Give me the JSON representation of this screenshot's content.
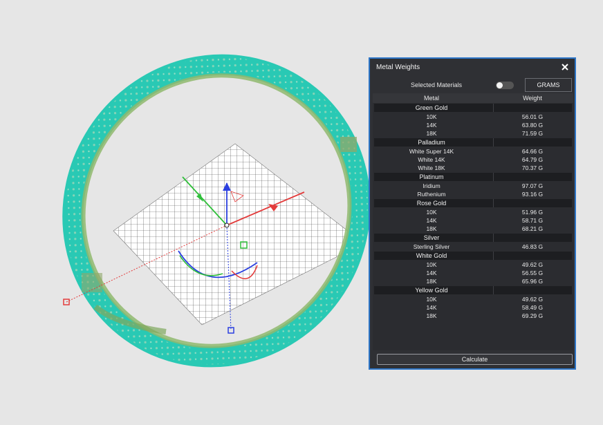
{
  "panel": {
    "title": "Metal Weights",
    "selected_label": "Selected Materials",
    "selected_toggle_on": false,
    "units_button": "GRAMS",
    "col_metal": "Metal",
    "col_weight": "Weight",
    "groups": [
      {
        "name": "Green Gold",
        "items": [
          {
            "name": "10K",
            "weight": "56.01 G"
          },
          {
            "name": "14K",
            "weight": "63.80 G"
          },
          {
            "name": "18K",
            "weight": "71.59 G"
          }
        ]
      },
      {
        "name": "Palladium",
        "items": [
          {
            "name": "White Super 14K",
            "weight": "64.66 G"
          },
          {
            "name": "White 14K",
            "weight": "64.79 G"
          },
          {
            "name": "White 18K",
            "weight": "70.37 G"
          }
        ]
      },
      {
        "name": "Platinum",
        "items": [
          {
            "name": "Iridium",
            "weight": "97.07 G"
          },
          {
            "name": "Ruthenium",
            "weight": "93.16 G"
          }
        ]
      },
      {
        "name": "Rose Gold",
        "items": [
          {
            "name": "10K",
            "weight": "51.96 G"
          },
          {
            "name": "14K",
            "weight": "58.71 G"
          },
          {
            "name": "18K",
            "weight": "68.21 G"
          }
        ]
      },
      {
        "name": "Silver",
        "items": [
          {
            "name": "Sterling Silver",
            "weight": "46.83 G"
          }
        ]
      },
      {
        "name": "White Gold",
        "items": [
          {
            "name": "10K",
            "weight": "49.62 G"
          },
          {
            "name": "14K",
            "weight": "56.55 G"
          },
          {
            "name": "18K",
            "weight": "65.96 G"
          }
        ]
      },
      {
        "name": "Yellow Gold",
        "items": [
          {
            "name": "10K",
            "weight": "49.62 G"
          },
          {
            "name": "14K",
            "weight": "58.49 G"
          },
          {
            "name": "18K",
            "weight": "69.29 G"
          }
        ]
      }
    ],
    "calculate_button": "Calculate"
  },
  "colors": {
    "accent_border": "#2d76c8",
    "ring": "#2fd4bf",
    "axis_x": "#e33b3b",
    "axis_y": "#2fbf3a",
    "axis_z": "#2a3fe0"
  },
  "icons": {
    "close": "close-icon",
    "gizmo": "transform-gizmo-icon"
  }
}
